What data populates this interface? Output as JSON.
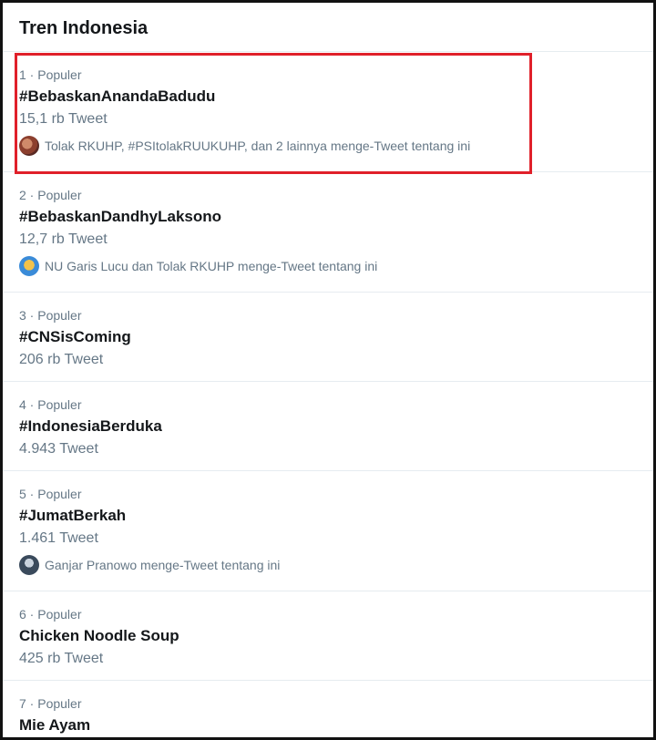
{
  "header": {
    "title": "Tren Indonesia"
  },
  "trends": [
    {
      "meta": "1 · Populer",
      "name": "#BebaskanAnandaBadudu",
      "count": "15,1 rb Tweet",
      "tweeted": "Tolak RKUHP, #PSItolakRUUKUHP, dan 2 lainnya menge-Tweet tentang ini"
    },
    {
      "meta": "2 · Populer",
      "name": "#BebaskanDandhyLaksono",
      "count": "12,7 rb Tweet",
      "tweeted": "NU Garis Lucu dan Tolak RKUHP menge-Tweet tentang ini"
    },
    {
      "meta": "3 · Populer",
      "name": "#CNSisComing",
      "count": "206 rb Tweet"
    },
    {
      "meta": "4 · Populer",
      "name": "#IndonesiaBerduka",
      "count": "4.943 Tweet"
    },
    {
      "meta": "5 · Populer",
      "name": "#JumatBerkah",
      "count": "1.461 Tweet",
      "tweeted": "Ganjar Pranowo menge-Tweet tentang ini"
    },
    {
      "meta": "6 · Populer",
      "name": "Chicken Noodle Soup",
      "count": "425 rb Tweet"
    },
    {
      "meta": "7 · Populer",
      "name": "Mie Ayam"
    }
  ],
  "colors": {
    "highlight": "#e0202a",
    "accent_text": "#14171a",
    "secondary_text": "#657786"
  }
}
